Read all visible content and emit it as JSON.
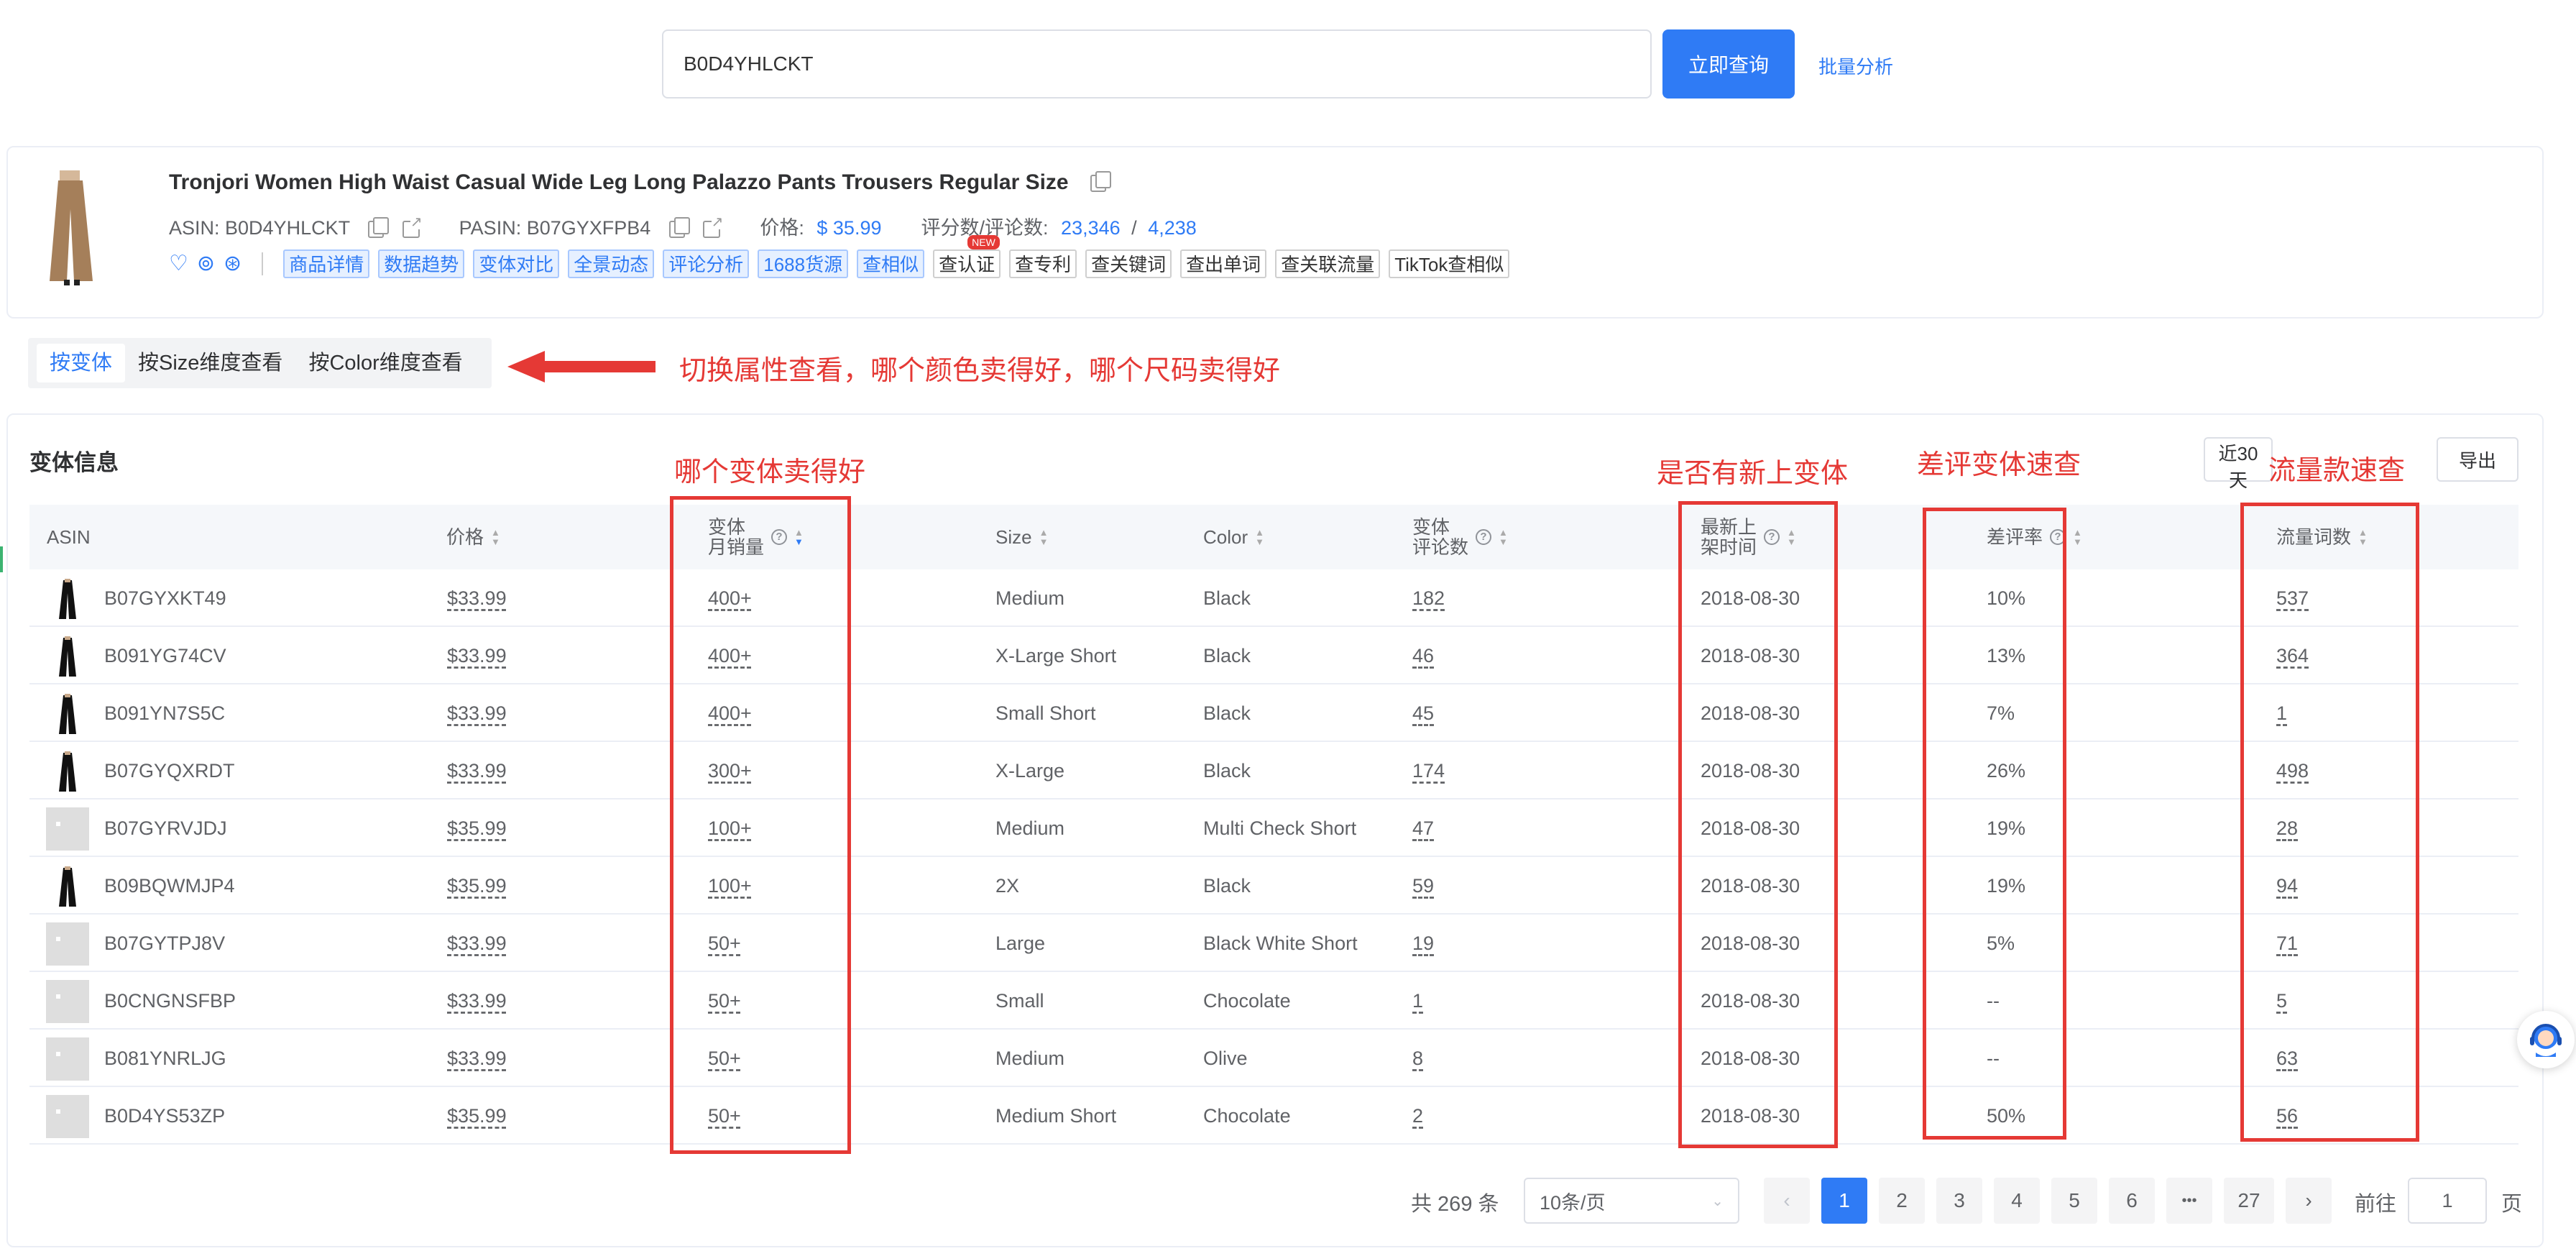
{
  "search": {
    "value": "B0D4YHLCKT",
    "button": "立即查询",
    "batch": "批量分析"
  },
  "product": {
    "title": "Tronjori Women High Waist Casual Wide Leg Long Palazzo Pants Trousers Regular Size",
    "asin_label": "ASIN: B0D4YHLCKT",
    "pasin_label": "PASIN: B07GYXFPB4",
    "price_label": "价格:",
    "price": "$ 35.99",
    "rating_label": "评分数/评论数:",
    "rating_count": "23,346",
    "rating_sep": "/",
    "review_count": "4,238",
    "icons": [
      "heart-icon",
      "medal-icon",
      "shield-icon"
    ],
    "tags_blue": [
      "商品详情",
      "数据趋势",
      "变体对比",
      "全景动态",
      "评论分析",
      "1688货源",
      "查相似"
    ],
    "tags_gray": [
      "查认证",
      "查专利",
      "查关键词",
      "查出单词",
      "查关联流量",
      "TikTok查相似"
    ],
    "new_badge": "NEW"
  },
  "view_tabs": [
    "按变体",
    "按Size维度查看",
    "按Color维度查看"
  ],
  "annotations": {
    "arrow_text": "切换属性查看，哪个颜色卖得好，哪个尺码卖得好",
    "sales": "哪个变体卖得好",
    "new_variant": "是否有新上变体",
    "bad_review": "差评变体速查",
    "traffic": "流量款速查"
  },
  "section": {
    "title": "变体信息",
    "range_button": "近30天",
    "export_button": "导出"
  },
  "table": {
    "headers": {
      "asin": "ASIN",
      "price": "价格",
      "sales_1": "变体",
      "sales_2": "月销量",
      "size": "Size",
      "color": "Color",
      "reviews_1": "变体",
      "reviews_2": "评论数",
      "date_1": "最新上",
      "date_2": "架时间",
      "bad_rate": "差评率",
      "traffic": "流量词数"
    },
    "rows": [
      {
        "asin": "B07GYXKT49",
        "price": "$33.99",
        "sales": "400+",
        "size": "Medium",
        "color": "Black",
        "reviews": "182",
        "date": "2018-08-30",
        "bad_rate": "10%",
        "traffic": "537",
        "thumb": "pants"
      },
      {
        "asin": "B091YG74CV",
        "price": "$33.99",
        "sales": "400+",
        "size": "X-Large Short",
        "color": "Black",
        "reviews": "46",
        "date": "2018-08-30",
        "bad_rate": "13%",
        "traffic": "364",
        "thumb": "pants"
      },
      {
        "asin": "B091YN7S5C",
        "price": "$33.99",
        "sales": "400+",
        "size": "Small Short",
        "color": "Black",
        "reviews": "45",
        "date": "2018-08-30",
        "bad_rate": "7%",
        "traffic": "1",
        "thumb": "pants"
      },
      {
        "asin": "B07GYQXRDT",
        "price": "$33.99",
        "sales": "300+",
        "size": "X-Large",
        "color": "Black",
        "reviews": "174",
        "date": "2018-08-30",
        "bad_rate": "26%",
        "traffic": "498",
        "thumb": "pants"
      },
      {
        "asin": "B07GYRVJDJ",
        "price": "$35.99",
        "sales": "100+",
        "size": "Medium",
        "color": "Multi Check Short",
        "reviews": "47",
        "date": "2018-08-30",
        "bad_rate": "19%",
        "traffic": "28",
        "thumb": "placeholder"
      },
      {
        "asin": "B09BQWMJP4",
        "price": "$35.99",
        "sales": "100+",
        "size": "2X",
        "color": "Black",
        "reviews": "59",
        "date": "2018-08-30",
        "bad_rate": "19%",
        "traffic": "94",
        "thumb": "pants"
      },
      {
        "asin": "B07GYTPJ8V",
        "price": "$33.99",
        "sales": "50+",
        "size": "Large",
        "color": "Black White Short",
        "reviews": "19",
        "date": "2018-08-30",
        "bad_rate": "5%",
        "traffic": "71",
        "thumb": "placeholder"
      },
      {
        "asin": "B0CNGNSFBP",
        "price": "$33.99",
        "sales": "50+",
        "size": "Small",
        "color": "Chocolate",
        "reviews": "1",
        "date": "2018-08-30",
        "bad_rate": "--",
        "traffic": "5",
        "thumb": "placeholder"
      },
      {
        "asin": "B081YNRLJG",
        "price": "$33.99",
        "sales": "50+",
        "size": "Medium",
        "color": "Olive",
        "reviews": "8",
        "date": "2018-08-30",
        "bad_rate": "--",
        "traffic": "63",
        "thumb": "placeholder"
      },
      {
        "asin": "B0D4YS53ZP",
        "price": "$35.99",
        "sales": "50+",
        "size": "Medium Short",
        "color": "Chocolate",
        "reviews": "2",
        "date": "2018-08-30",
        "bad_rate": "50%",
        "traffic": "56",
        "thumb": "placeholder"
      }
    ]
  },
  "pagination": {
    "total": "共 269 条",
    "page_size": "10条/页",
    "pages": [
      "1",
      "2",
      "3",
      "4",
      "5",
      "6"
    ],
    "ellipsis": "•••",
    "last_page": "27",
    "current": "1",
    "goto_label": "前往",
    "goto_value": "1",
    "goto_suffix": "页",
    "prev": "‹",
    "next": "›"
  },
  "colors": {
    "accent": "#2f7bf5",
    "annotation": "#e53935"
  }
}
